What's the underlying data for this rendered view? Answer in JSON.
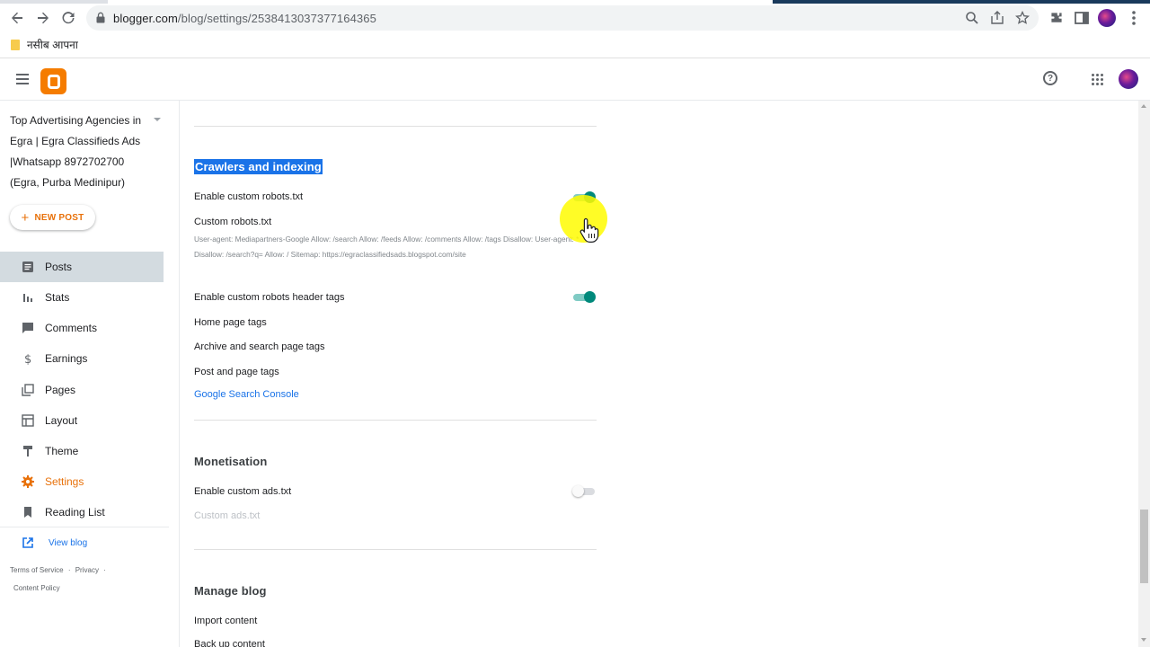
{
  "browser": {
    "url_host": "blogger.com",
    "url_path": "/blog/settings/2538413037377164365",
    "bookmark": "नसीब आपना",
    "icons": [
      "back-arrow-icon",
      "forward-arrow-icon",
      "reload-icon",
      "lock-icon",
      "zoom-icon",
      "share-icon",
      "star-icon",
      "extensions-icon",
      "side-panel-icon",
      "profile-icon",
      "menu-dots-icon"
    ]
  },
  "app": {
    "help_label": "?"
  },
  "sidebar": {
    "blog_title": "Top Advertising Agencies in Egra | Egra Classifieds Ads |Whatsapp 8972702700 (Egra, Purba Medinipur)",
    "new_post": "NEW POST",
    "items": [
      {
        "label": "Posts",
        "icon": "posts-icon"
      },
      {
        "label": "Stats",
        "icon": "stats-icon"
      },
      {
        "label": "Comments",
        "icon": "comments-icon"
      },
      {
        "label": "Earnings",
        "icon": "dollar-icon"
      },
      {
        "label": "Pages",
        "icon": "pages-icon"
      },
      {
        "label": "Layout",
        "icon": "layout-icon"
      },
      {
        "label": "Theme",
        "icon": "theme-icon"
      },
      {
        "label": "Settings",
        "icon": "gear-icon"
      },
      {
        "label": "Reading List",
        "icon": "bookmark-icon"
      }
    ],
    "view_blog": "View blog",
    "footer": {
      "terms": "Terms of Service",
      "sep1": "·",
      "privacy": "Privacy",
      "sep2": "·",
      "content_policy": "Content Policy"
    }
  },
  "main": {
    "crawlers": {
      "title": "Crawlers and indexing",
      "enable_robots": "Enable custom robots.txt",
      "enable_robots_on": true,
      "custom_robots": "Custom robots.txt",
      "robots_content": "User-agent: Mediapartners-Google Allow: /search Allow: /feeds Allow: /comments Allow: /tags Disallow: User-agent: * Disallow: /search?q= Allow: / Sitemap: https://egraclassifiedsads.blogspot.com/site",
      "enable_header_tags": "Enable custom robots header tags",
      "enable_header_tags_on": true,
      "home_tags": "Home page tags",
      "archive_tags": "Archive and search page tags",
      "post_tags": "Post and page tags",
      "search_console": "Google Search Console"
    },
    "monetisation": {
      "title": "Monetisation",
      "enable_ads": "Enable custom ads.txt",
      "enable_ads_on": false,
      "custom_ads": "Custom ads.txt"
    },
    "manage": {
      "title": "Manage blog",
      "import": "Import content",
      "backup": "Back up content"
    }
  },
  "colors": {
    "brand": "#f57c00",
    "accent": "#1a73e8",
    "toggle_on": "#00897b",
    "settings_active": "#e8710a"
  }
}
